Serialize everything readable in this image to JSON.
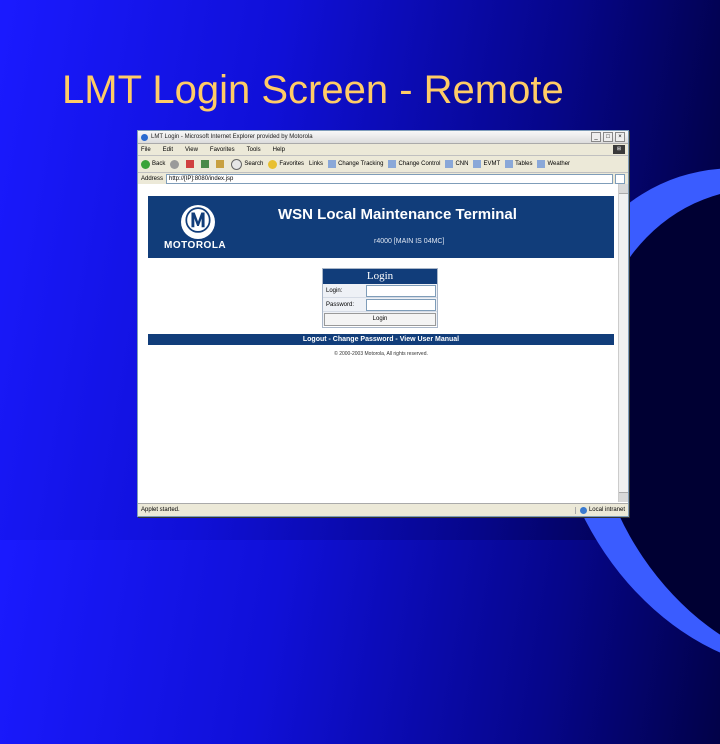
{
  "slide": {
    "title": "LMT Login Screen - Remote"
  },
  "browser": {
    "window_title": "LMT Login - Microsoft Internet Explorer provided by Motorola",
    "menu": [
      "File",
      "Edit",
      "View",
      "Favorites",
      "Tools",
      "Help"
    ],
    "toolbar": [
      "Back",
      "Search",
      "Favorites",
      "Links",
      "Change Tracking",
      "Change Control",
      "CNN",
      "EVMT",
      "Tables",
      "Weather"
    ],
    "address_label": "Address",
    "address_url": "http://[IP]:8080/index.jsp",
    "status_left": "Applet started.",
    "status_zone": "Local intranet"
  },
  "page": {
    "brand": "MOTOROLA",
    "app_title": "WSN Local Maintenance Terminal",
    "app_subtitle": "r4000 [MAIN IS 04MC]",
    "login": {
      "heading": "Login",
      "login_label": "Login:",
      "password_label": "Password:",
      "button_label": "Login"
    },
    "links": "Logout - Change Password - View User Manual",
    "copyright": "© 2000-2003 Motorola, All rights reserved."
  },
  "colors": {
    "banner": "#113d7a",
    "title": "#ffcc66"
  }
}
